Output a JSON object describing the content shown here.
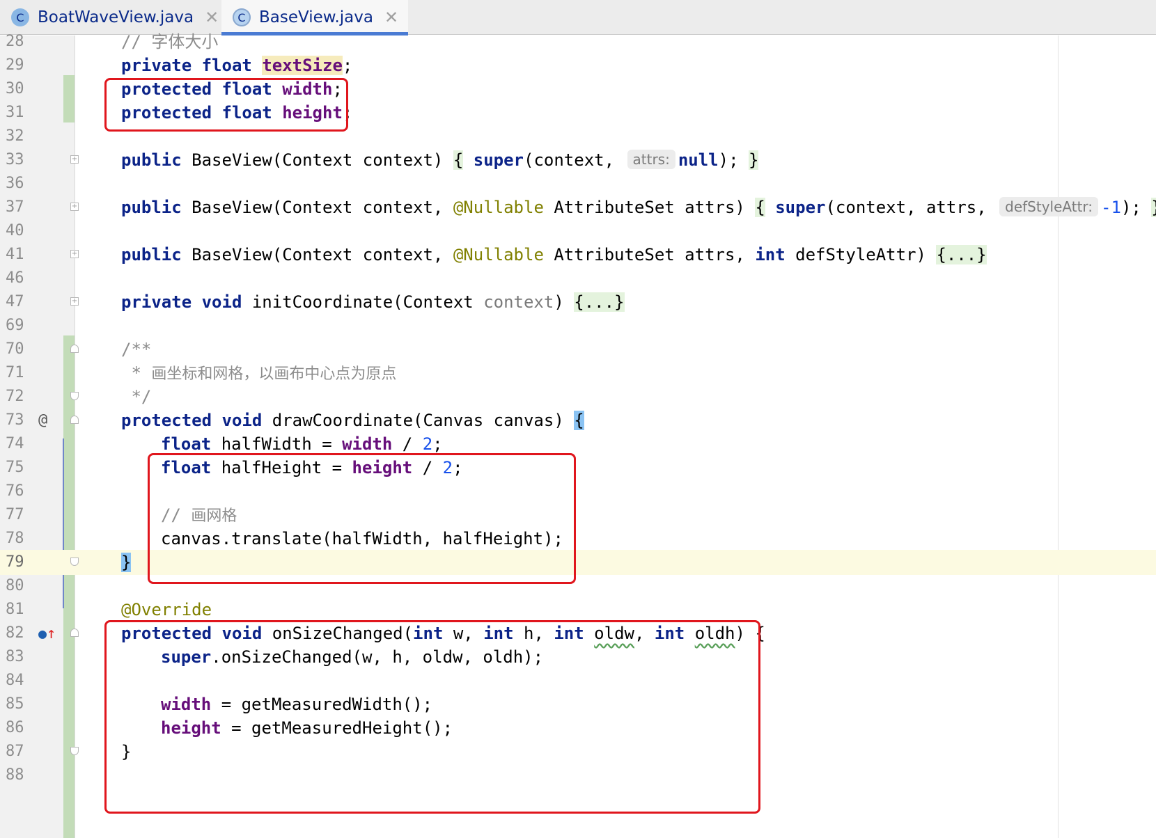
{
  "tabs": [
    {
      "name": "BoatWaveView.java",
      "icon": "C",
      "active": false,
      "close": "✕"
    },
    {
      "name": "BaseView.java",
      "icon": "C",
      "active": true,
      "close": "✕"
    }
  ],
  "line_numbers": [
    "28",
    "29",
    "30",
    "31",
    "32",
    "33",
    "36",
    "37",
    "40",
    "41",
    "46",
    "47",
    "69",
    "70",
    "71",
    "72",
    "73",
    "74",
    "75",
    "76",
    "77",
    "78",
    "79",
    "80",
    "81",
    "82",
    "83",
    "84",
    "85",
    "86",
    "87",
    "88"
  ],
  "code": {
    "l28": {
      "comment": "// 字体大小"
    },
    "l29": {
      "kw1": "private",
      "kw2": "float",
      "field": "textSize",
      "end": ";"
    },
    "l30": {
      "kw1": "protected",
      "kw2": "float",
      "field": "width",
      "end": ";"
    },
    "l31": {
      "kw1": "protected",
      "kw2": "float",
      "field": "height",
      "end": ";"
    },
    "l33": {
      "kw": "public",
      "sig": " BaseView(Context context) ",
      "b1": "{",
      "kw_super": "super",
      "args": "(context, ",
      "hint": "attrs:",
      "kw_null": "null",
      "tail": "); ",
      "b2": "}"
    },
    "l37": {
      "kw": "public",
      "sig1": " BaseView(Context context, ",
      "ann": "@Nullable",
      "sig2": " AttributeSet attrs) ",
      "b1": "{",
      "kw_super": "super",
      "args": "(context, attrs, ",
      "hint": "defStyleAttr:",
      "num": "-1",
      "tail": "); ",
      "b2": "}"
    },
    "l41": {
      "kw": "public",
      "sig1": " BaseView(Context context, ",
      "ann": "@Nullable",
      "sig2": " AttributeSet attrs, ",
      "kw_int": "int",
      "sig3": " defStyleAttr) ",
      "fold": "{...}"
    },
    "l47": {
      "kw1": "private",
      "kw2": "void",
      "sig": " initCoordinate(Context ",
      "param": "context",
      "close": ") ",
      "fold": "{...}"
    },
    "l70": {
      "text": "/**"
    },
    "l71": {
      "star": " * ",
      "text": "画坐标和网格，以画布中心点为原点"
    },
    "l72": {
      "text": " */"
    },
    "l73": {
      "kw1": "protected",
      "kw2": "void",
      "sig": " drawCoordinate(Canvas canvas) ",
      "brace": "{"
    },
    "l74": {
      "kw": "float",
      "mid": " halfWidth = ",
      "field": "width",
      "op": " / ",
      "num": "2",
      "end": ";"
    },
    "l75": {
      "kw": "float",
      "mid": " halfHeight = ",
      "field": "height",
      "op": " / ",
      "num": "2",
      "end": ";"
    },
    "l77": {
      "slashes": "// ",
      "text": "画网格"
    },
    "l78": {
      "text": "canvas.translate(halfWidth, halfHeight);"
    },
    "l79": {
      "brace": "}"
    },
    "l81": {
      "ann": "@Override"
    },
    "l82": {
      "kw1": "protected",
      "kw2": "void",
      "sig": " onSizeChanged(",
      "int1": "int",
      "w": " w, ",
      "int2": "int",
      "h": " h, ",
      "int3": "int",
      "oldw": "oldw",
      "comma": ", ",
      "int4": "int",
      "oldh": "oldh",
      "tail": ") {"
    },
    "l83": {
      "kw": "super",
      "rest": ".onSizeChanged(w, h, oldw, oldh);"
    },
    "l85": {
      "field": "width",
      "rest": " = getMeasuredWidth();"
    },
    "l86": {
      "field": "height",
      "rest": " = getMeasuredHeight();"
    },
    "l87": {
      "brace": "}"
    }
  },
  "gutter_icons": {
    "l73": "@",
    "l82": "↑"
  },
  "colors": {
    "keyword": "#0b2388",
    "field": "#660e7a",
    "number": "#1750eb",
    "annotation": "#808000",
    "comment": "#8c8c8c",
    "highlight_box": "#e0161d"
  }
}
